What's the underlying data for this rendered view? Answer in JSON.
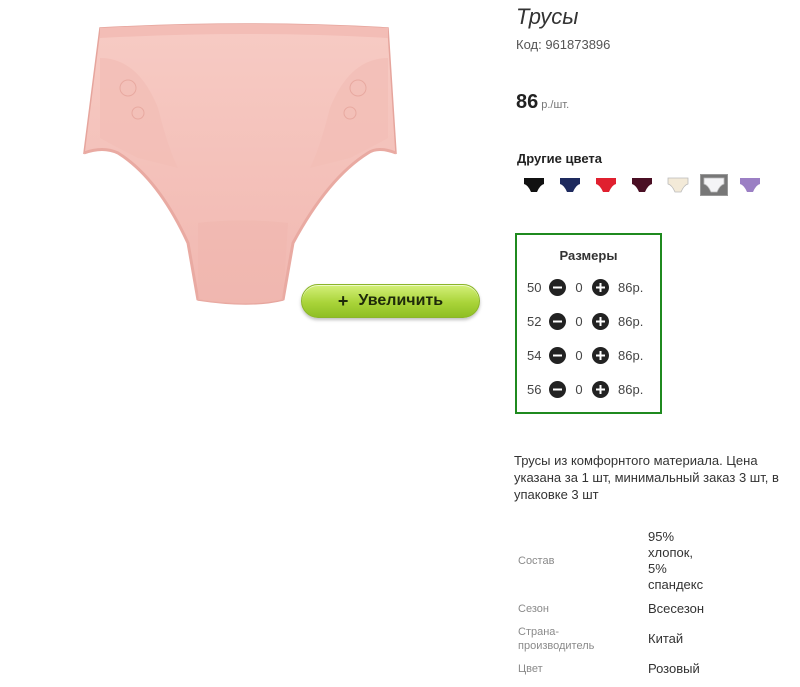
{
  "product": {
    "title": "Трусы",
    "code": "Код: 961873896",
    "price_value": "86",
    "price_unit": "р./шт.",
    "zoom_label": "Увеличить"
  },
  "colors": {
    "title": "Другие цвета",
    "swatches": [
      {
        "name": "black",
        "hex": "#111111"
      },
      {
        "name": "navy",
        "hex": "#1e2a5e"
      },
      {
        "name": "red",
        "hex": "#e0202f"
      },
      {
        "name": "burgundy",
        "hex": "#4a0f24"
      },
      {
        "name": "cream",
        "hex": "#f3ead8"
      },
      {
        "name": "white",
        "hex": "#f4f4f6",
        "selected": true
      },
      {
        "name": "lavender",
        "hex": "#9b7fc4"
      }
    ]
  },
  "sizes": {
    "title": "Размеры",
    "rows": [
      {
        "size": "50",
        "qty": "0",
        "price": "86р."
      },
      {
        "size": "52",
        "qty": "0",
        "price": "86р."
      },
      {
        "size": "54",
        "qty": "0",
        "price": "86р."
      },
      {
        "size": "56",
        "qty": "0",
        "price": "86р."
      }
    ]
  },
  "description": {
    "line1": "Трусы из комфорнтого материала. Цена",
    "line2": "указана за 1 шт, минимальный заказ 3 шт, в",
    "line3": "упаковке 3 шт"
  },
  "attributes": {
    "composition_label": "Состав",
    "composition_value": [
      "95%",
      "хлопок,",
      "5%",
      "спандекс"
    ],
    "season_label": "Сезон",
    "season_value": "Всесезон",
    "country_label": [
      "Страна-",
      "производитель"
    ],
    "country_value": "Китай",
    "color_label": "Цвет",
    "color_value": "Розовый"
  },
  "palette": {
    "panties": "#f5c4bd",
    "accent_green": "#1f8a1f",
    "zoom_button": "#a9d439"
  }
}
